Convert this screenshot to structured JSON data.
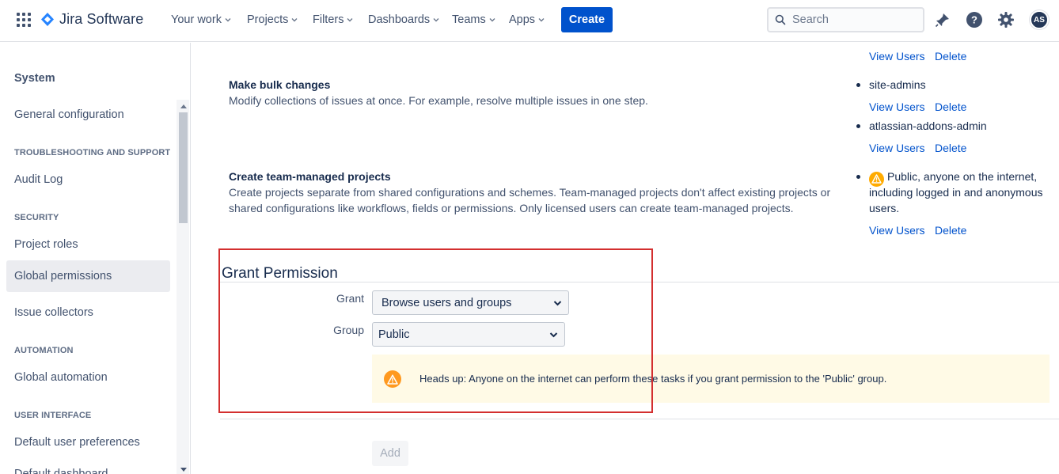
{
  "topnav": {
    "product_name": "Jira Software",
    "items": [
      {
        "label": "Your work"
      },
      {
        "label": "Projects"
      },
      {
        "label": "Filters"
      },
      {
        "label": "Dashboards"
      },
      {
        "label": "Teams"
      },
      {
        "label": "Apps"
      }
    ],
    "create_label": "Create",
    "search_placeholder": "Search",
    "avatar_initials": "AS",
    "icons": [
      "app-switcher-icon",
      "jira-logo-icon",
      "notifications-icon",
      "help-icon",
      "settings-icon"
    ]
  },
  "sidebar": {
    "title": "System",
    "item_general": "General configuration",
    "heading_troubleshooting": "TROUBLESHOOTING AND SUPPORT",
    "item_audit": "Audit Log",
    "heading_security": "SECURITY",
    "item_project_roles": "Project roles",
    "item_global_permissions": "Global permissions",
    "item_issue_collectors": "Issue collectors",
    "heading_automation": "AUTOMATION",
    "item_global_automation": "Global automation",
    "heading_ui": "USER INTERFACE",
    "item_default_prefs": "Default user preferences",
    "item_default_dashboard": "Default dashboard"
  },
  "permissions": {
    "top_view_users": "View Users",
    "top_delete": "Delete",
    "bulk": {
      "title": "Make bulk changes",
      "description": "Modify collections of issues at once. For example, resolve multiple issues in one step.",
      "groups": [
        {
          "name": "site-admins",
          "view_users": "View Users",
          "delete": "Delete"
        },
        {
          "name": "atlassian-addons-admin",
          "view_users": "View Users",
          "delete": "Delete"
        }
      ]
    },
    "team_managed": {
      "title": "Create team-managed projects",
      "description_line1": "Create projects separate from shared configurations and schemes. Team-managed projects don't affect existing projects or",
      "description_line2": "shared configurations like workflows, fields or permissions. Only licensed users can create team-managed projects.",
      "public_line1": "Public, anyone on the internet,",
      "public_line2": "including logged in and anonymous",
      "public_line3": "users.",
      "view_users": "View Users",
      "delete": "Delete"
    }
  },
  "grant_form": {
    "heading": "Grant Permission",
    "grant_label": "Grant",
    "grant_value": "Browse users and groups",
    "group_label": "Group",
    "group_value": "Public",
    "notice": "Heads up: Anyone on the internet can perform these tasks if you grant permission to the 'Public' group.",
    "add_label": "Add"
  },
  "colors": {
    "brand": "#0052cc",
    "warning": "#ff991f",
    "notice_bg": "#fffae6",
    "highlight_border": "#d32f2f"
  }
}
